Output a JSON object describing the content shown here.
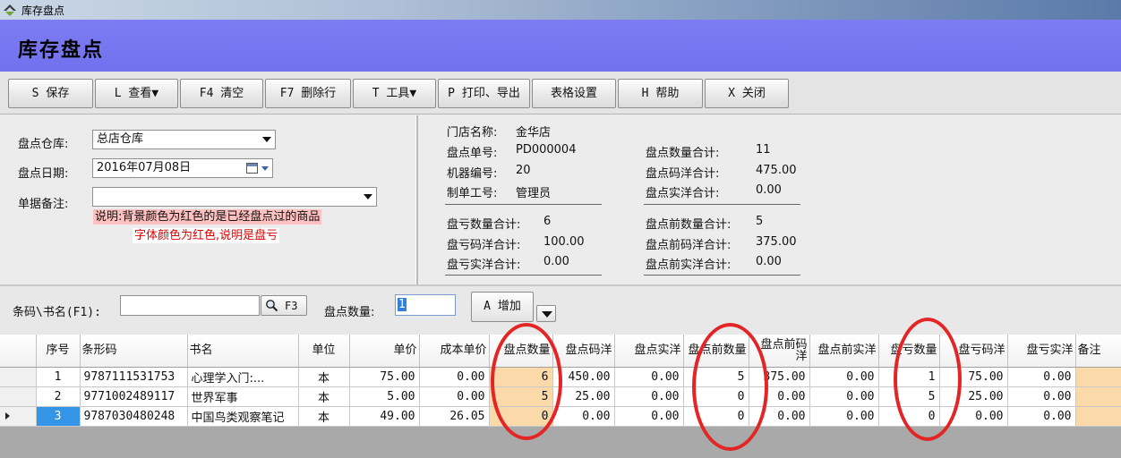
{
  "window": {
    "title": "库存盘点"
  },
  "header": {
    "title": "库存盘点"
  },
  "toolbar": [
    {
      "key": "save",
      "label": "S 保存"
    },
    {
      "key": "view",
      "label": "L 查看▼"
    },
    {
      "key": "clear",
      "label": "F4 清空"
    },
    {
      "key": "delete_row",
      "label": "F7 删除行"
    },
    {
      "key": "tools",
      "label": "T 工具▼"
    },
    {
      "key": "print",
      "label": "P 打印、导出"
    },
    {
      "key": "table_settings",
      "label": "表格设置"
    },
    {
      "key": "help",
      "label": "H 帮助"
    },
    {
      "key": "close",
      "label": "X 关闭"
    }
  ],
  "form": {
    "warehouse_label": "盘点仓库:",
    "warehouse_value": "总店仓库",
    "date_label": "盘点日期:",
    "date_value": "2016年07月08日",
    "remark_label": "单据备注:",
    "remark_value": "",
    "note_line1": "说明:背景颜色为红色的是已经盘点过的商品",
    "note_line2": "字体颜色为红色,说明是盘亏"
  },
  "info": {
    "store_label": "门店名称:",
    "store_value": "金华店",
    "order_label": "盘点单号:",
    "order_value": "PD000004",
    "machine_label": "机器编号:",
    "machine_value": "20",
    "operator_label": "制单工号:",
    "operator_value": "管理员",
    "count_qty_label": "盘点数量合计:",
    "count_qty_value": "11",
    "count_code_label": "盘点码洋合计:",
    "count_code_value": "475.00",
    "count_real_label": "盘点实洋合计:",
    "count_real_value": "0.00",
    "loss_qty_label": "盘亏数量合计:",
    "loss_qty_value": "6",
    "loss_code_label": "盘亏码洋合计:",
    "loss_code_value": "100.00",
    "loss_real_label": "盘亏实洋合计:",
    "loss_real_value": "0.00",
    "pre_qty_label": "盘点前数量合计:",
    "pre_qty_value": "5",
    "pre_code_label": "盘点前码洋合计:",
    "pre_code_value": "375.00",
    "pre_real_label": "盘点前实洋合计:",
    "pre_real_value": "0.00"
  },
  "search": {
    "barcode_label": "条码\\书名(F1):",
    "barcode_value": "",
    "search_button": "F3",
    "qty_label": "盘点数量:",
    "qty_value": "1",
    "add_button": "A 增加"
  },
  "table": {
    "columns": [
      "",
      "序号",
      "条形码",
      "书名",
      "单位",
      "单价",
      "成本单价",
      "盘点数量",
      "盘点码洋",
      "盘点实洋",
      "盘点前数量",
      "盘点前码洋",
      "盘点前实洋",
      "盘亏数量",
      "盘亏码洋",
      "盘亏实洋",
      "备注"
    ],
    "rows": [
      [
        "1",
        "9787111531753",
        "心理学入门:...",
        "本",
        "75.00",
        "0.00",
        "6",
        "450.00",
        "0.00",
        "5",
        "375.00",
        "0.00",
        "1",
        "75.00",
        "0.00",
        ""
      ],
      [
        "2",
        "9771002489117",
        "世界军事",
        "本",
        "5.00",
        "0.00",
        "5",
        "25.00",
        "0.00",
        "0",
        "0.00",
        "0.00",
        "5",
        "25.00",
        "0.00",
        ""
      ],
      [
        "3",
        "9787030480248",
        "中国鸟类观察笔记",
        "本",
        "49.00",
        "26.05",
        "0",
        "0.00",
        "0.00",
        "0",
        "0.00",
        "0.00",
        "0",
        "0.00",
        "0.00",
        ""
      ]
    ]
  },
  "colors": {
    "header_band": "#7271ee",
    "highlight_cell": "#fbd9a9",
    "selected_cell": "#3495e6",
    "annotation_ring": "#e32525",
    "note_bg": "#ffc0c0",
    "note_red_text": "#e00000"
  }
}
